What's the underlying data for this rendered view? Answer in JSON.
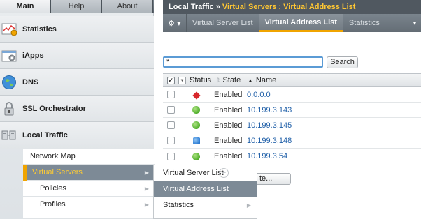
{
  "nav_tabs": [
    {
      "label": "Main",
      "state": "active"
    },
    {
      "label": "Help",
      "state": "inactive"
    },
    {
      "label": "About",
      "state": "inactive"
    }
  ],
  "nav_sections": [
    {
      "label": "Statistics",
      "icon": "statistics-icon"
    },
    {
      "label": "iApps",
      "icon": "iapps-icon"
    },
    {
      "label": "DNS",
      "icon": "dns-globe-icon"
    },
    {
      "label": "SSL Orchestrator",
      "icon": "ssl-lock-icon"
    },
    {
      "label": "Local Traffic",
      "icon": "local-traffic-icon"
    }
  ],
  "local_traffic_items": [
    {
      "label": "Network Map",
      "has_submenu": false
    },
    {
      "label": "Virtual Servers",
      "has_submenu": true,
      "highlighted": true
    },
    {
      "label": "Policies",
      "has_submenu": true
    },
    {
      "label": "Profiles",
      "has_submenu": true
    }
  ],
  "flyout_items": [
    {
      "label": "Virtual Server List",
      "has_add": true
    },
    {
      "label": "Virtual Address List",
      "highlighted": true
    },
    {
      "label": "Statistics",
      "has_submenu": true
    }
  ],
  "breadcrumb": {
    "section": "Local Traffic",
    "separator": "»",
    "page": "Virtual Servers : Virtual Address List"
  },
  "subnav": {
    "gear": "⚙ ▾",
    "tabs": [
      {
        "label": "Virtual Server List",
        "active": false
      },
      {
        "label": "Virtual Address List",
        "active": true
      },
      {
        "label": "Statistics",
        "active": false
      }
    ],
    "menu_arrow": "▾"
  },
  "search": {
    "value": "*",
    "button_label": "Search"
  },
  "table": {
    "columns": [
      "Status",
      "State",
      "Name"
    ],
    "sort_indicator": "▲",
    "rows": [
      {
        "status": "red-diamond",
        "state": "Enabled",
        "name": "0.0.0.0"
      },
      {
        "status": "green-circle",
        "state": "Enabled",
        "name": "10.199.3.143"
      },
      {
        "status": "green-circle",
        "state": "Enabled",
        "name": "10.199.3.145"
      },
      {
        "status": "blue-square",
        "state": "Enabled",
        "name": "10.199.3.148"
      },
      {
        "status": "green-circle",
        "state": "Enabled",
        "name": "10.199.3.54"
      }
    ]
  },
  "partial_button": "te...",
  "colors": {
    "accent": "#f0a400",
    "breadcrumb_page": "#ffc733",
    "link": "#1f5fa8"
  }
}
